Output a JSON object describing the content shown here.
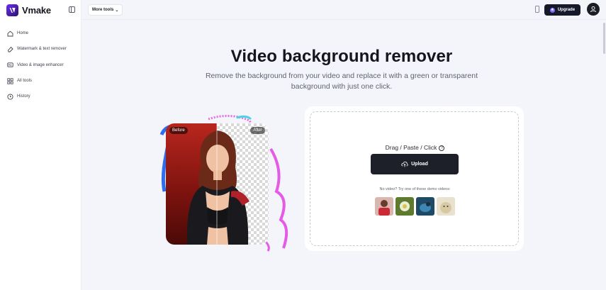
{
  "app": {
    "brand": "Vmake"
  },
  "sidebar": {
    "items": [
      {
        "label": "Home",
        "icon": "home-icon"
      },
      {
        "label": "Watermark & text remover",
        "icon": "eraser-icon"
      },
      {
        "label": "Video & image enhancer",
        "icon": "hd-icon"
      },
      {
        "label": "All tools",
        "icon": "grid-icon"
      },
      {
        "label": "History",
        "icon": "clock-icon"
      }
    ]
  },
  "topbar": {
    "more_tools": "More tools",
    "upgrade": "Upgrade"
  },
  "hero": {
    "title": "Video background remover",
    "subtitle": "Remove the background from your video and replace it with a green or transparent background with just one click."
  },
  "illustration": {
    "before_tag": "Before",
    "after_tag": "After"
  },
  "upload": {
    "drop_label": "Drag / Paste / Click",
    "button_label": "Upload",
    "demo_label": "No video? Try one of these demo videos:"
  },
  "colors": {
    "brand": "#6a2cf5",
    "dark": "#16192a",
    "background": "#f4f5fa"
  }
}
